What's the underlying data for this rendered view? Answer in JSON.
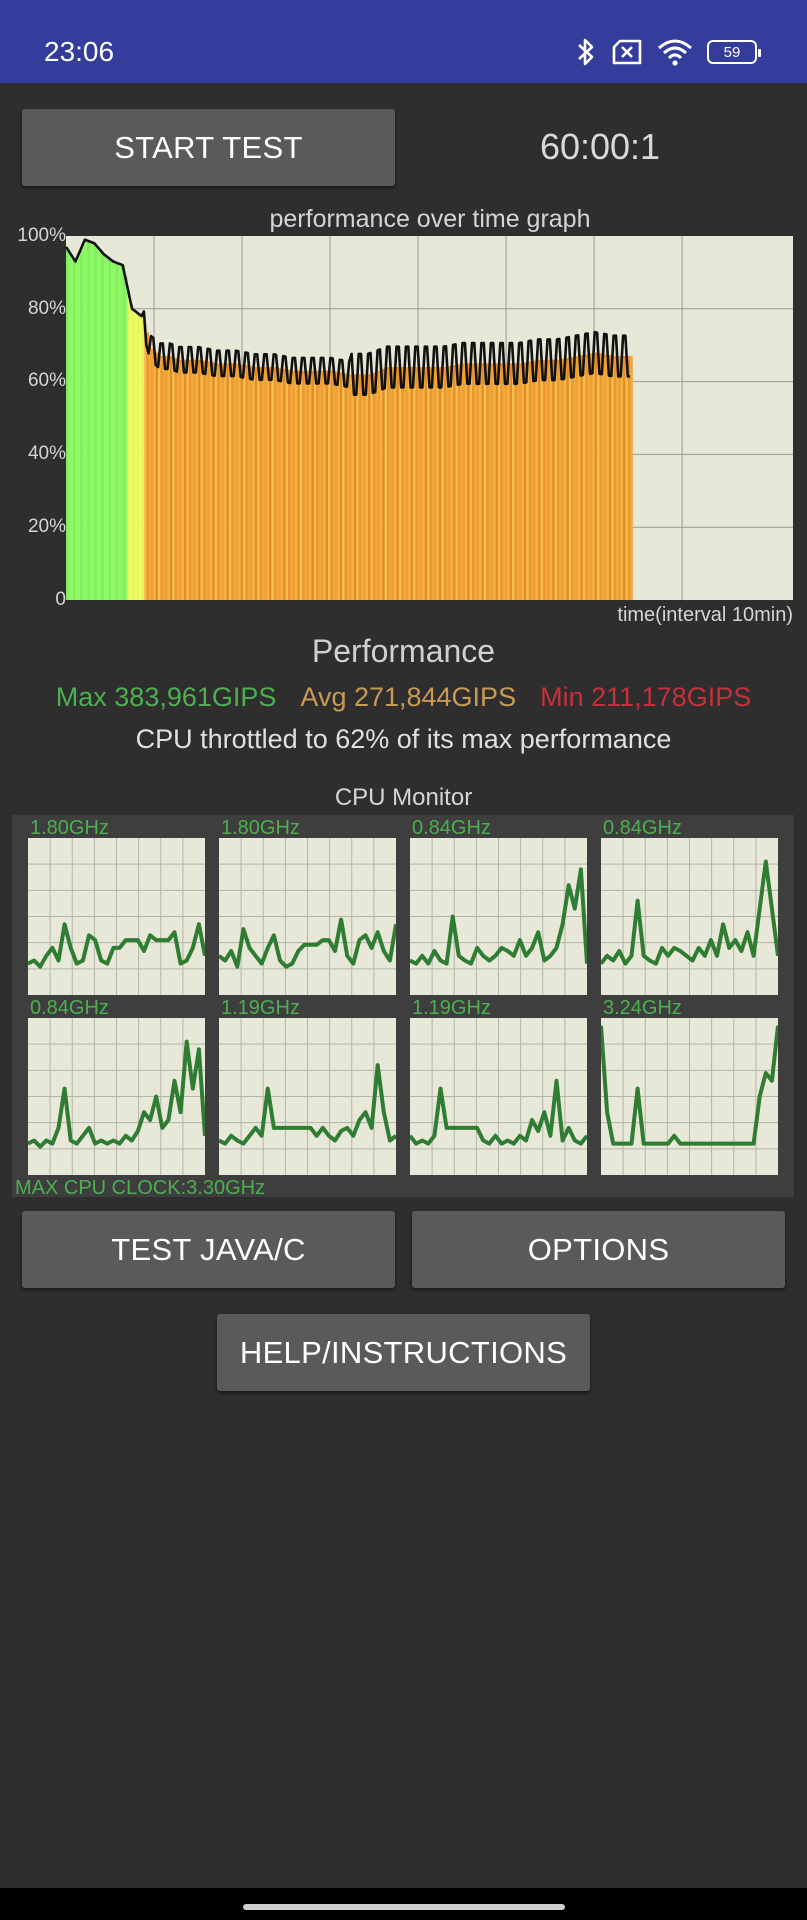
{
  "status_bar": {
    "time": "23:06",
    "battery": "59",
    "icons": [
      "bluetooth-icon",
      "sim-disabled-icon",
      "wifi-icon",
      "battery-icon"
    ]
  },
  "controls": {
    "start_label": "START TEST",
    "timer": "60:00:1",
    "test_java_label": "TEST JAVA/C",
    "options_label": "OPTIONS",
    "help_label": "HELP/INSTRUCTIONS"
  },
  "graph": {
    "title": "performance over time graph",
    "y_labels": [
      "100%",
      "80%",
      "60%",
      "40%",
      "20%",
      "0"
    ],
    "x_label": "time(interval 10min)"
  },
  "performance": {
    "title": "Performance",
    "max": "Max 383,961GIPS",
    "avg": "Avg 271,844GIPS",
    "min": "Min 211,178GIPS",
    "throttle": "CPU throttled to 62% of its max performance"
  },
  "cpu_monitor": {
    "title": "CPU Monitor",
    "cores": [
      {
        "freq": "1.80GHz"
      },
      {
        "freq": "1.80GHz"
      },
      {
        "freq": "0.84GHz"
      },
      {
        "freq": "0.84GHz"
      },
      {
        "freq": "0.84GHz"
      },
      {
        "freq": "1.19GHz"
      },
      {
        "freq": "1.19GHz"
      },
      {
        "freq": "3.24GHz"
      }
    ],
    "max_clock": "MAX CPU CLOCK:3.30GHz"
  },
  "chart_data": {
    "type": "area",
    "title": "performance over time graph",
    "xlabel": "time(interval 10min)",
    "ylabel": "",
    "ylim": [
      0,
      100
    ],
    "xlim": [
      0,
      60
    ],
    "grid": true,
    "x": [
      0,
      1,
      2,
      3,
      4,
      5,
      6,
      7,
      8,
      9,
      10,
      11,
      12,
      14,
      16,
      18,
      20,
      22,
      24,
      26,
      28,
      30,
      32,
      34,
      36,
      38,
      40,
      42,
      44,
      46,
      48,
      50,
      52,
      54,
      56,
      58,
      60
    ],
    "values": [
      97,
      93,
      99,
      98,
      95,
      93,
      92,
      80,
      78,
      69,
      67,
      67,
      66,
      66,
      65,
      65,
      64,
      64,
      63,
      63,
      63,
      62,
      62,
      64,
      64,
      64,
      64,
      65,
      65,
      65,
      65,
      66,
      66,
      67,
      68,
      67,
      67
    ]
  }
}
